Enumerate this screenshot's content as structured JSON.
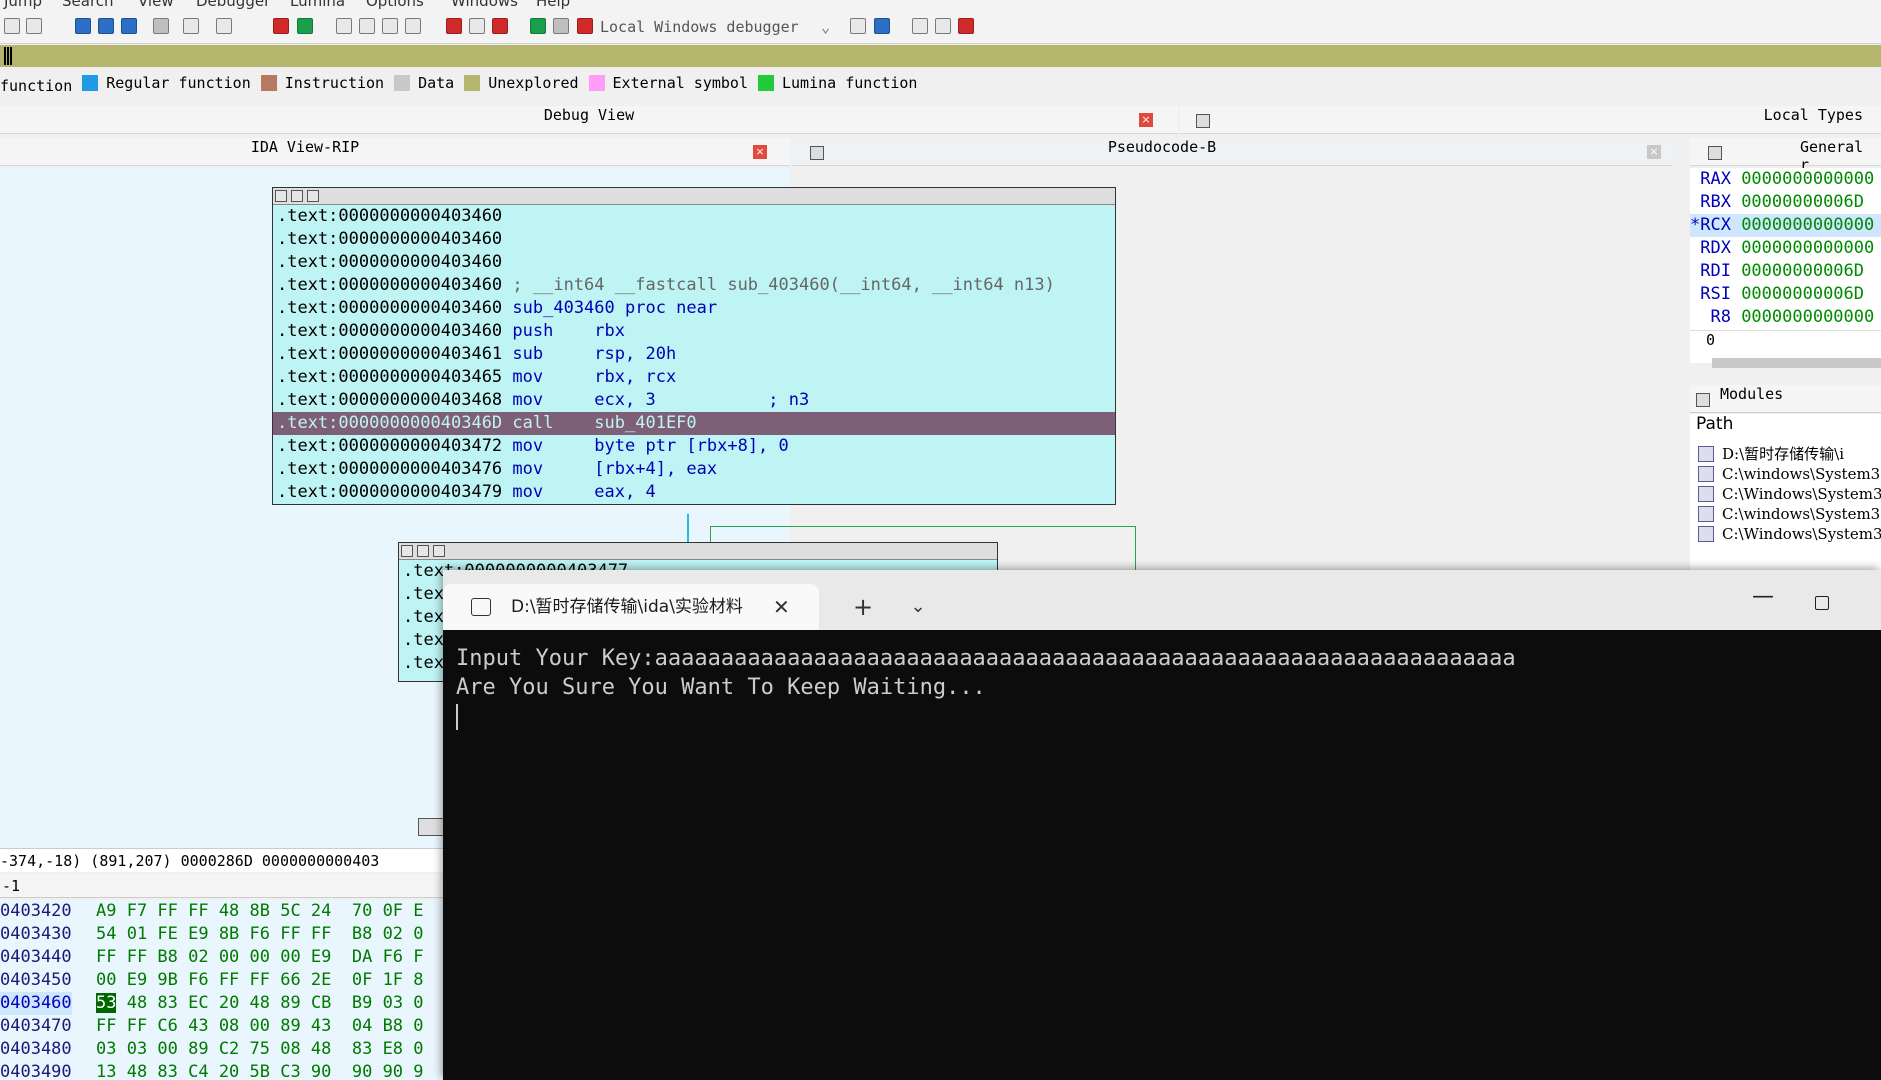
{
  "menu": [
    "Jump",
    "Search",
    "View",
    "Debugger",
    "Lumina",
    "Options",
    "Windows",
    "Help"
  ],
  "toolbar": {
    "debugger_select": "Local Windows debugger"
  },
  "legend": [
    {
      "label": "function",
      "color": null
    },
    {
      "label": "Regular function",
      "color": "#1f9be6"
    },
    {
      "label": "Instruction",
      "color": "#b67a5e"
    },
    {
      "label": "Data",
      "color": "#c8c8c8"
    },
    {
      "label": "Unexplored",
      "color": "#b5b56e"
    },
    {
      "label": "External symbol",
      "color": "#ff9cf7"
    },
    {
      "label": "Lumina function",
      "color": "#22c93a"
    }
  ],
  "panes": {
    "debug_view": "Debug View",
    "local_types": "Local Types",
    "ida_view": "IDA View-RIP",
    "pseudocode": "Pseudocode-B",
    "general_regs": "General r",
    "modules": "Modules",
    "path_header": "Path"
  },
  "node1": {
    "lines": [
      {
        "addr": ".text:0000000000403460",
        "mn": "",
        "op": ""
      },
      {
        "addr": ".text:0000000000403460",
        "mn": "",
        "op": ""
      },
      {
        "addr": ".text:0000000000403460",
        "mn": "",
        "op": ""
      },
      {
        "addr": ".text:0000000000403460",
        "mn": "; __int64 __fastcall sub_403460(__int64, __int64 n13)",
        "op": "",
        "comment": true
      },
      {
        "addr": ".text:0000000000403460",
        "mn": "sub_403460 proc near",
        "op": ""
      },
      {
        "addr": ".text:0000000000403460",
        "mn": "push",
        "op": "rbx"
      },
      {
        "addr": ".text:0000000000403461",
        "mn": "sub",
        "op": "rsp, 20h"
      },
      {
        "addr": ".text:0000000000403465",
        "mn": "mov",
        "op": "rbx, rcx"
      },
      {
        "addr": ".text:0000000000403468",
        "mn": "mov",
        "op": "ecx, 3           ; n3"
      },
      {
        "addr": ".text:000000000040346D",
        "mn": "call",
        "op": "sub_401EF0",
        "selected": true
      },
      {
        "addr": ".text:0000000000403472",
        "mn": "mov",
        "op": "byte ptr [rbx+8], 0"
      },
      {
        "addr": ".text:0000000000403476",
        "mn": "mov",
        "op": "[rbx+4], eax"
      },
      {
        "addr": ".text:0000000000403479",
        "mn": "mov",
        "op": "eax, 4"
      }
    ]
  },
  "node2": {
    "lines": [
      ".text:0000000000403477",
      ".tex",
      ".tex",
      ".tex",
      ".tex"
    ]
  },
  "status_bar": "-374,-18) (891,207) 0000286D 0000000000403",
  "hex_title": "-1",
  "hex_rows": [
    {
      "addr": "0403420",
      "bytes": "A9 F7 FF FF 48 8B 5C 24  70 0F E"
    },
    {
      "addr": "0403430",
      "bytes": "54 01 FE E9 8B F6 FF FF  B8 02 0"
    },
    {
      "addr": "0403440",
      "bytes": "FF FF B8 02 00 00 00 E9  DA F6 F"
    },
    {
      "addr": "0403450",
      "bytes": "00 E9 9B F6 FF FF 66 2E  0F 1F 8"
    },
    {
      "addr": "0403460",
      "bytes": "53 48 83 EC 20 48 89 CB  B9 03 0",
      "current": true
    },
    {
      "addr": "0403470",
      "bytes": "FF FF C6 43 08 00 89 43  04 B8 0"
    },
    {
      "addr": "0403480",
      "bytes": "03 03 00 89 C2 75 08 48  83 E8 0"
    },
    {
      "addr": "0403490",
      "bytes": "13 48 83 C4 20 5B C3 90  90 90 9"
    }
  ],
  "registers": [
    {
      "name": "RAX",
      "value": "0000000000000"
    },
    {
      "name": "RBX",
      "value": "00000000006D"
    },
    {
      "name": "*RCX",
      "value": "0000000000000",
      "highlight": true
    },
    {
      "name": "RDX",
      "value": "0000000000000"
    },
    {
      "name": "RDI",
      "value": "00000000006D"
    },
    {
      "name": "RSI",
      "value": "00000000006D"
    },
    {
      "name": "R8",
      "value": "0000000000000"
    }
  ],
  "register_footer": "0",
  "modules": [
    "D:\\暂时存储传输\\i",
    "C:\\windows\\System3",
    "C:\\Windows\\System3",
    "C:\\windows\\System3",
    "C:\\Windows\\System3"
  ],
  "terminal": {
    "tab_title": "D:\\暂时存储传输\\ida\\实验材料",
    "lines": [
      "Input Your Key:aaaaaaaaaaaaaaaaaaaaaaaaaaaaaaaaaaaaaaaaaaaaaaaaaaaaaaaaaaaaaaaaa",
      "Are You Sure You Want To Keep Waiting..."
    ]
  }
}
